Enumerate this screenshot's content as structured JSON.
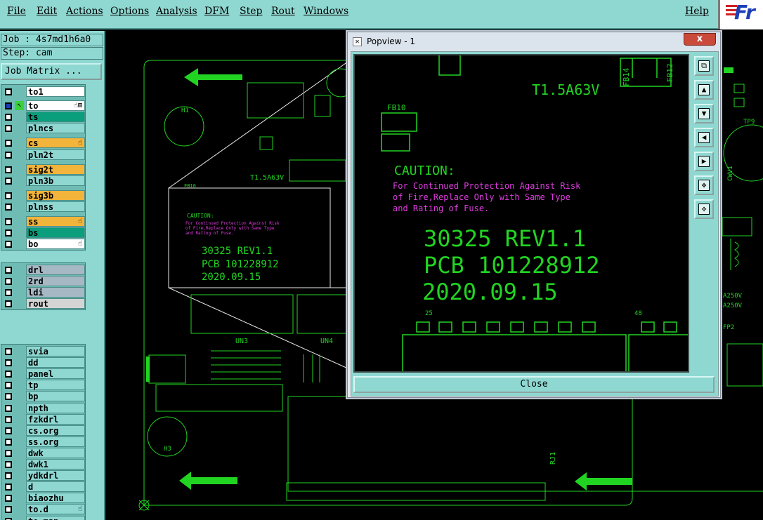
{
  "menu": [
    "File",
    "Edit",
    "Actions",
    "Options",
    "Analysis",
    "DFM",
    "Step",
    "Rout",
    "Windows"
  ],
  "help_label": "Help",
  "logo_text": "Fr",
  "job_label": "Job : 4s7md1h6a0",
  "step_label": "Step: cam",
  "job_matrix_button": "Job Matrix ...",
  "layers": [
    {
      "name": "to1",
      "color": "white",
      "checked": false,
      "hand": ""
    },
    {
      "name": "to",
      "color": "white",
      "checked": true,
      "hand": "☝⊞"
    },
    {
      "name": "ts",
      "color": "green",
      "checked": false,
      "hand": ""
    },
    {
      "name": "plncs",
      "color": "cyan",
      "checked": false,
      "hand": ""
    },
    {
      "name": "cs",
      "color": "orange",
      "checked": false,
      "hand": "☝"
    },
    {
      "name": "pln2t",
      "color": "cyan",
      "checked": false,
      "hand": ""
    },
    {
      "name": "sig2t",
      "color": "orange",
      "checked": false,
      "hand": ""
    },
    {
      "name": "pln3b",
      "color": "cyan",
      "checked": false,
      "hand": ""
    },
    {
      "name": "sig3b",
      "color": "orange",
      "checked": false,
      "hand": ""
    },
    {
      "name": "plnss",
      "color": "cyan",
      "checked": false,
      "hand": ""
    },
    {
      "name": "ss",
      "color": "orange",
      "checked": false,
      "hand": "☝"
    },
    {
      "name": "bs",
      "color": "green",
      "checked": false,
      "hand": ""
    },
    {
      "name": "bo",
      "color": "white",
      "checked": false,
      "hand": "☝"
    },
    {
      "name": "drl",
      "color": "grey",
      "checked": false,
      "hand": ""
    },
    {
      "name": "2rd",
      "color": "grey",
      "checked": false,
      "hand": ""
    },
    {
      "name": "ldi",
      "color": "grey",
      "checked": false,
      "hand": ""
    },
    {
      "name": "rout",
      "color": "ltgrey",
      "checked": false,
      "hand": ""
    },
    {
      "name": "svia",
      "color": "cyan",
      "checked": false,
      "hand": ""
    },
    {
      "name": "dd",
      "color": "cyan",
      "checked": false,
      "hand": ""
    },
    {
      "name": "panel",
      "color": "cyan",
      "checked": false,
      "hand": ""
    },
    {
      "name": "tp",
      "color": "cyan",
      "checked": false,
      "hand": ""
    },
    {
      "name": "bp",
      "color": "cyan",
      "checked": false,
      "hand": ""
    },
    {
      "name": "npth",
      "color": "cyan",
      "checked": false,
      "hand": ""
    },
    {
      "name": "fzkdrl",
      "color": "cyan",
      "checked": false,
      "hand": ""
    },
    {
      "name": "cs.org",
      "color": "cyan",
      "checked": false,
      "hand": ""
    },
    {
      "name": "ss.org",
      "color": "cyan",
      "checked": false,
      "hand": ""
    },
    {
      "name": "dwk",
      "color": "cyan",
      "checked": false,
      "hand": ""
    },
    {
      "name": "dwk1",
      "color": "cyan",
      "checked": false,
      "hand": ""
    },
    {
      "name": "ydkdrl",
      "color": "cyan",
      "checked": false,
      "hand": ""
    },
    {
      "name": "d",
      "color": "cyan",
      "checked": false,
      "hand": ""
    },
    {
      "name": "biaozhu",
      "color": "cyan",
      "checked": false,
      "hand": ""
    },
    {
      "name": "to.d",
      "color": "cyan",
      "checked": false,
      "hand": "☝"
    },
    {
      "name": "to_map",
      "color": "cyan",
      "checked": false,
      "hand": ""
    }
  ],
  "popview": {
    "title": "Popview - 1",
    "close_x": "x",
    "close_button": "Close",
    "tools": [
      "zoom-fit-icon",
      "pan-up-icon",
      "pan-down-icon",
      "pan-left-icon",
      "pan-right-icon",
      "zoom-out-icon",
      "zoom-in-icon"
    ]
  },
  "board_text": {
    "caution": "CAUTION:",
    "warn1": "For Continued Protection Against Risk",
    "warn2": "of Fire,Replace Only with Same Type",
    "warn3": "and Rating of Fuse.",
    "rev": "30325 REV1.1",
    "pcb": "PCB 101228912",
    "date": "2020.09.15",
    "fuse": "T1.5A63V",
    "fb10": "FB10",
    "fb14": "FB14",
    "fb12": "FB12",
    "un3": "UN3",
    "un4": "UN4",
    "h1": "H1",
    "h3": "H3",
    "rj1": "RJ1",
    "tp9": "TP9",
    "cwv1": "CWV1",
    "a250a": "A250V",
    "a250b": "A250V",
    "fp2": "FP2",
    "n25": "25",
    "n48": "48"
  },
  "colors": {
    "panel": "#8fd8d2",
    "board_green": "#22d422",
    "silk_magenta": "#e03ce0",
    "canvas": "#000000"
  }
}
